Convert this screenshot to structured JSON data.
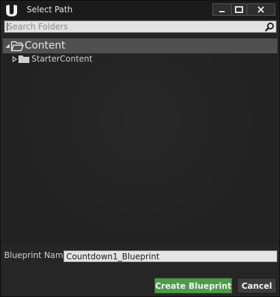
{
  "window": {
    "title": "Select Path",
    "logo": "unreal-engine-logo",
    "controls": [
      "minimize-icon",
      "maximize-icon",
      "close-icon"
    ]
  },
  "search": {
    "placeholder": "Search Folders",
    "value": "",
    "icon": "search-icon"
  },
  "tree": {
    "root": {
      "label": "Content",
      "expanded": true,
      "selected": true,
      "icon": "folder-open-icon"
    },
    "children": [
      {
        "label": "StarterContent",
        "expanded": false,
        "icon": "folder-icon"
      }
    ]
  },
  "blueprint_name": {
    "label": "Blueprint Name",
    "value": "Countdown1_Blueprint"
  },
  "buttons": {
    "create": "Create Blueprint",
    "cancel": "Cancel"
  },
  "colors": {
    "accent_green": "#4d9a4a",
    "selection": "#505050",
    "background": "#262626"
  }
}
